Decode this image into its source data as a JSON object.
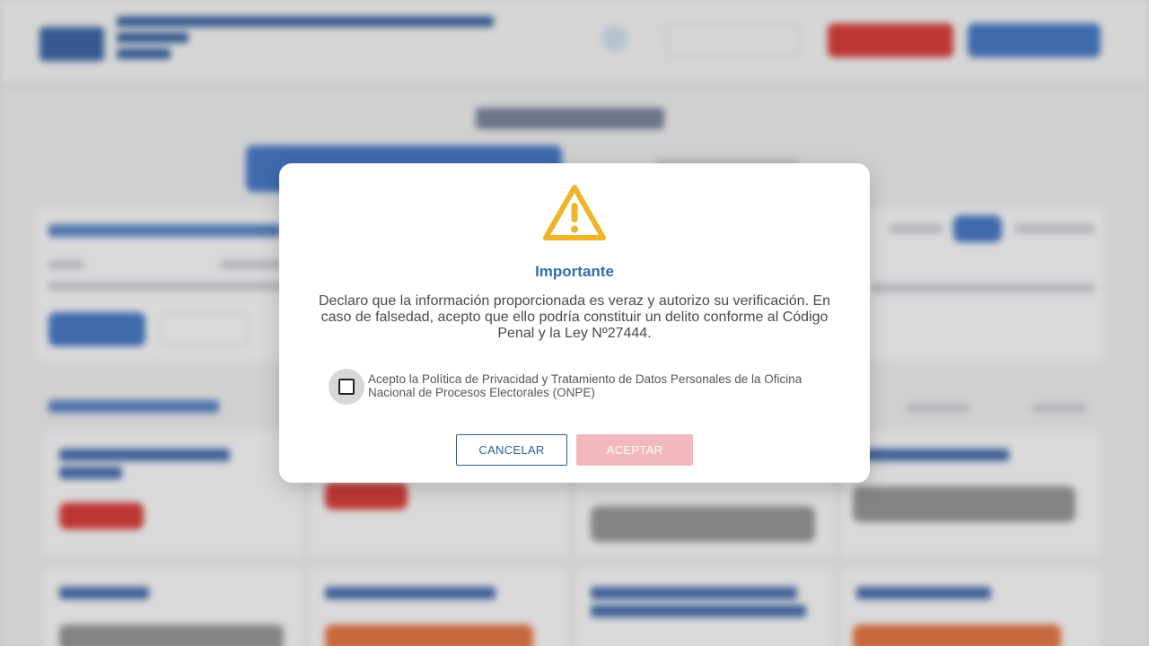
{
  "modal": {
    "title": "Importante",
    "body": "Declaro que la información proporcionada es veraz y autorizo su verificación. En caso de falsedad, acepto que ello podría constituir un delito conforme al Código Penal y la Ley Nº27444.",
    "consent_label": "Acepto la Política de Privacidad y Tratamiento de Datos Personales de la Oficina Nacional de Procesos Electorales (ONPE)",
    "consent_checked": false,
    "cancel_label": "CANCELAR",
    "accept_label": "ACEPTAR",
    "icon": "warning-triangle-icon"
  },
  "colors": {
    "title": "#2f6db0",
    "warning": "#f0b429",
    "cancel_border": "#2b5d9a",
    "accept_disabled": "#f2b9bd"
  }
}
